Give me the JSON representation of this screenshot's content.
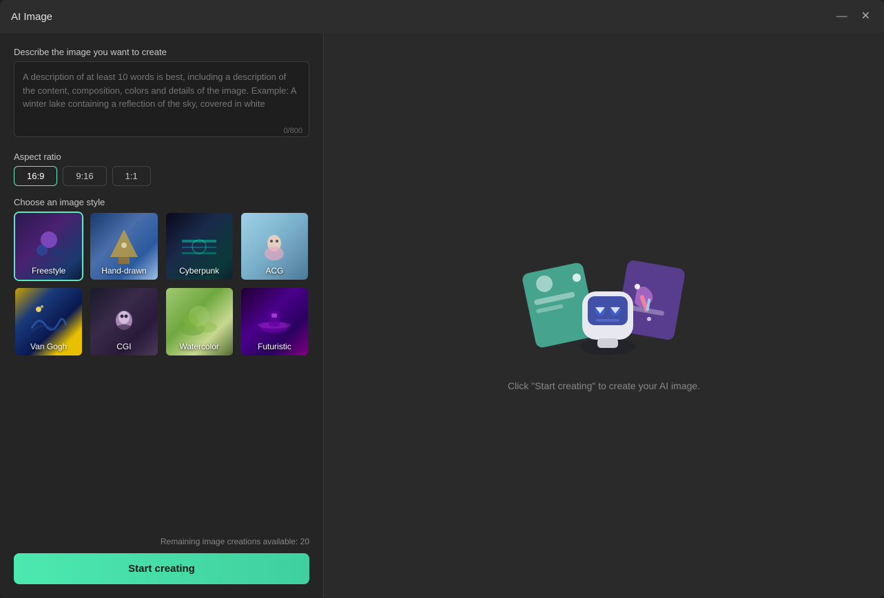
{
  "window": {
    "title": "AI Image"
  },
  "titlebar": {
    "minimize_label": "—",
    "close_label": "✕"
  },
  "left": {
    "describe_label": "Describe the image you want to create",
    "textarea_placeholder": "A description of at least 10 words is best, including a description of the content, composition, colors and details of the image. Example: A winter lake containing a reflection of the sky, covered in white",
    "char_count": "0/800",
    "aspect_ratio_label": "Aspect ratio",
    "aspect_options": [
      {
        "value": "16:9",
        "active": true
      },
      {
        "value": "9:16",
        "active": false
      },
      {
        "value": "1:1",
        "active": false
      }
    ],
    "style_label": "Choose an image style",
    "styles": [
      {
        "id": "freestyle",
        "label": "Freestyle",
        "selected": true
      },
      {
        "id": "hand-drawn",
        "label": "Hand-drawn",
        "selected": false
      },
      {
        "id": "cyberpunk",
        "label": "Cyberpunk",
        "selected": false
      },
      {
        "id": "acg",
        "label": "ACG",
        "selected": false
      },
      {
        "id": "vangogh",
        "label": "Van Gogh",
        "selected": false
      },
      {
        "id": "cgi",
        "label": "CGI",
        "selected": false
      },
      {
        "id": "watercolor",
        "label": "Watercolor",
        "selected": false
      },
      {
        "id": "futuristic",
        "label": "Futuristic",
        "selected": false
      }
    ],
    "remaining_text": "Remaining image creations available: 20",
    "start_btn_label": "Start creating"
  },
  "right": {
    "empty_state_text": "Click \"Start creating\" to create your AI image."
  }
}
